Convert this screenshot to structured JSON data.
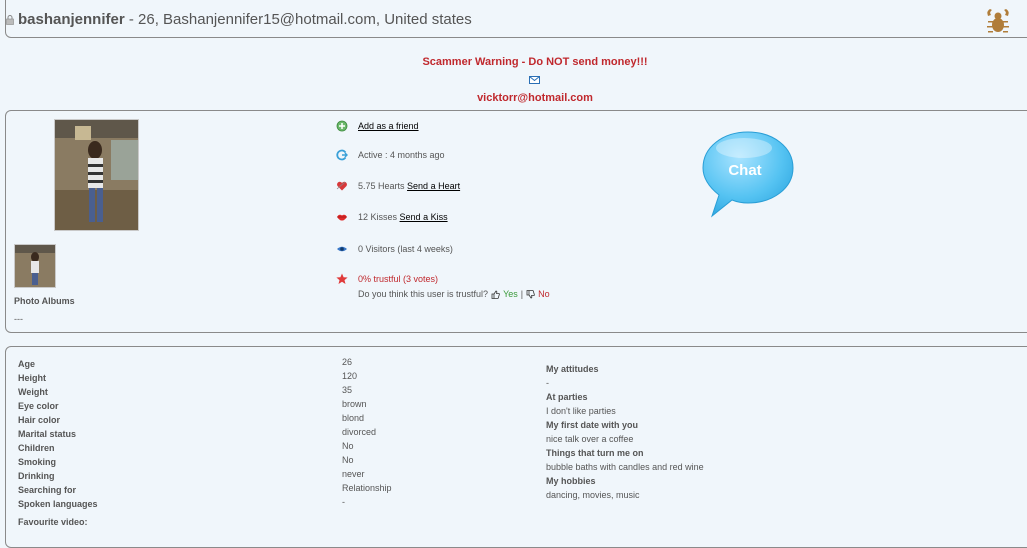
{
  "header": {
    "username": "bashanjennifer",
    "info": " - 26, Bashanjennifer15@hotmail.com, United states"
  },
  "warning": {
    "title": "Scammer Warning - Do NOT send money!!!",
    "email": "vicktorr@hotmail.com"
  },
  "photos": {
    "albums_label": "Photo Albums",
    "albums_value": "---"
  },
  "actions": {
    "add_friend": "Add as a friend",
    "active": "Active : 4 months ago",
    "hearts": "5.75 Hearts ",
    "send_heart": "Send a Heart",
    "kisses": "12 Kisses ",
    "send_kiss": "Send a Kiss",
    "visitors": "0 Visitors (last 4 weeks)",
    "trustful": "0% trustful (3 votes)",
    "trust_question": "Do you think this user is trustful?",
    "yes": "Yes",
    "separator": "|",
    "no": "No"
  },
  "chat": {
    "label": "Chat"
  },
  "details": [
    {
      "label": "Age",
      "value": "26"
    },
    {
      "label": "Height",
      "value": "120"
    },
    {
      "label": "Weight",
      "value": "35"
    },
    {
      "label": "Eye color",
      "value": "brown"
    },
    {
      "label": "Hair color",
      "value": "blond"
    },
    {
      "label": "Marital status",
      "value": "divorced"
    },
    {
      "label": "Children",
      "value": "No"
    },
    {
      "label": "Smoking",
      "value": "No"
    },
    {
      "label": "Drinking",
      "value": "never"
    },
    {
      "label": "Searching for",
      "value": "Relationship"
    },
    {
      "label": "Spoken languages",
      "value": "-"
    },
    {
      "label": "Favourite video:",
      "value": ""
    }
  ],
  "about": [
    {
      "label": "My attitudes",
      "value": "-"
    },
    {
      "label": "At parties",
      "value": "I don't like parties"
    },
    {
      "label": "My first date with you",
      "value": "nice talk over a coffee"
    },
    {
      "label": "Things that turn me on",
      "value": "bubble baths with candles and red wine"
    },
    {
      "label": "My hobbies",
      "value": "dancing, movies, music"
    }
  ]
}
